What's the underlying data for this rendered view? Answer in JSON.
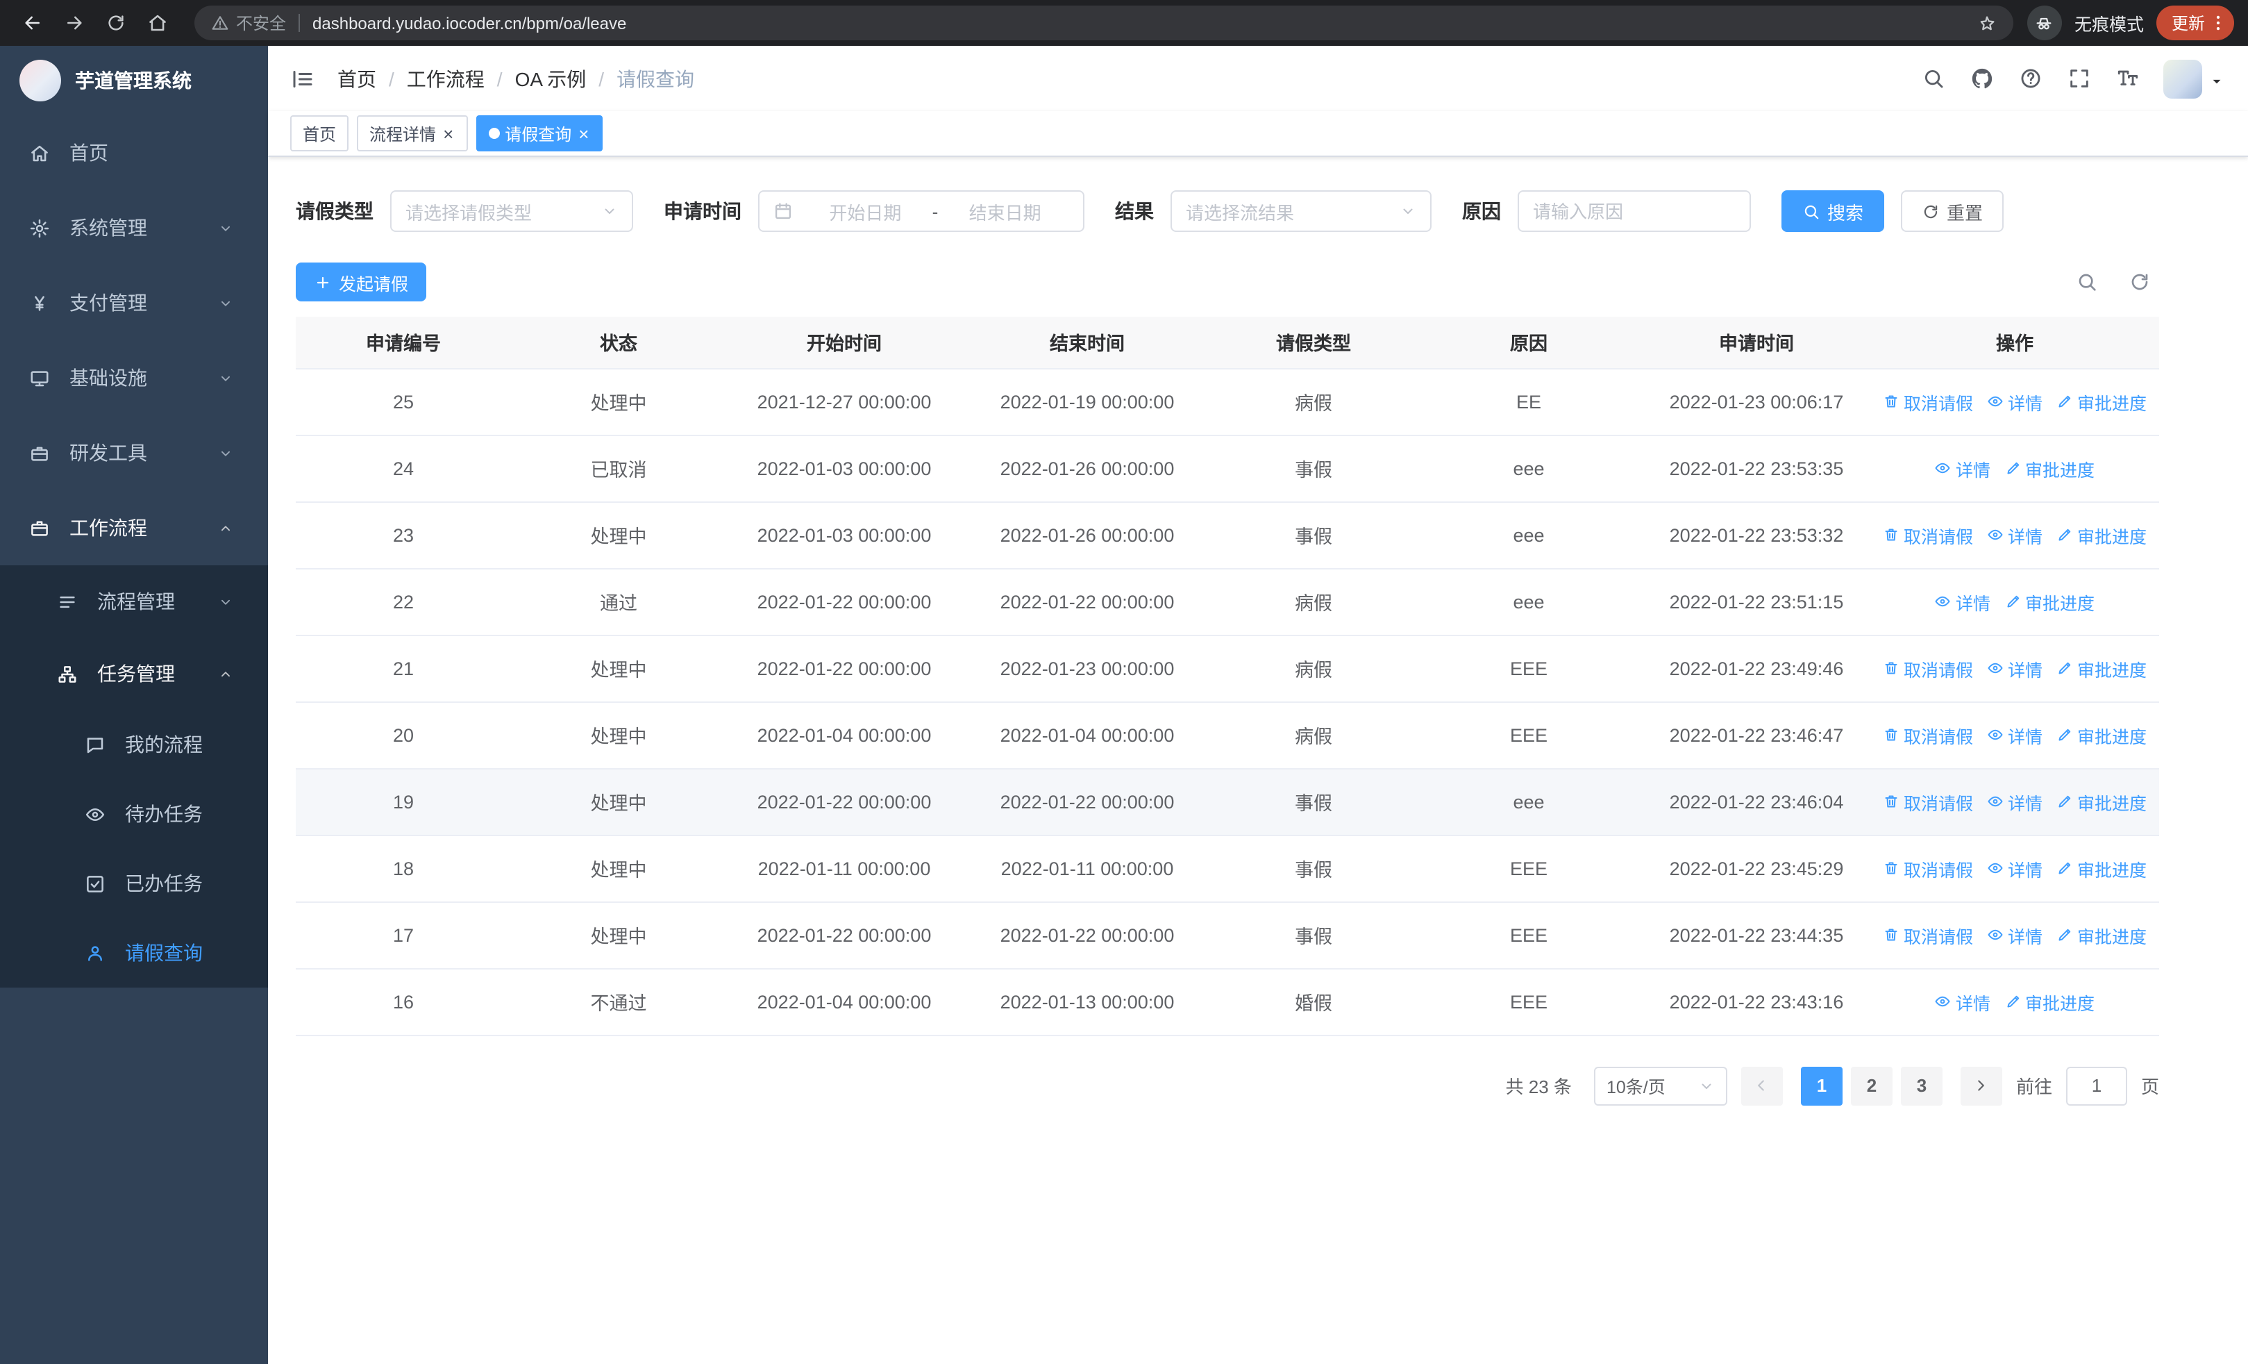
{
  "colors": {
    "primary": "#409eff",
    "sidebar_bg": "#304156",
    "sidebar_sub_bg": "#1f2d3d"
  },
  "browser": {
    "security_label": "不安全",
    "url": "dashboard.yudao.iocoder.cn/bpm/oa/leave",
    "incognito_label": "无痕模式",
    "update_label": "更新"
  },
  "sidebar": {
    "app_title": "芋道管理系统",
    "items": [
      {
        "id": "home",
        "label": "首页",
        "icon": "home-icon",
        "level": 1
      },
      {
        "id": "system-mgmt",
        "label": "系统管理",
        "icon": "gear-icon",
        "level": 1,
        "chevron": "down"
      },
      {
        "id": "payment-mgmt",
        "label": "支付管理",
        "icon": "yen-icon",
        "level": 1,
        "chevron": "down"
      },
      {
        "id": "infrastructure",
        "label": "基础设施",
        "icon": "monitor-icon",
        "level": 1,
        "chevron": "down"
      },
      {
        "id": "dev-tools",
        "label": "研发工具",
        "icon": "toolbox-icon",
        "level": 1,
        "chevron": "down"
      },
      {
        "id": "workflow",
        "label": "工作流程",
        "icon": "briefcase-icon",
        "level": 1,
        "chevron": "up",
        "open": true
      },
      {
        "id": "process-mgmt",
        "label": "流程管理",
        "icon": "flow-icon",
        "level": 2,
        "chevron": "down"
      },
      {
        "id": "task-mgmt",
        "label": "任务管理",
        "icon": "org-icon",
        "level": 2,
        "chevron": "up",
        "open": true
      },
      {
        "id": "my-process",
        "label": "我的流程",
        "icon": "chat-icon",
        "level": 3
      },
      {
        "id": "todo-tasks",
        "label": "待办任务",
        "icon": "eye-icon",
        "level": 3
      },
      {
        "id": "done-tasks",
        "label": "已办任务",
        "icon": "check-icon",
        "level": 3
      },
      {
        "id": "leave-query",
        "label": "请假查询",
        "icon": "user-icon",
        "level": 3,
        "active": true
      }
    ]
  },
  "header": {
    "breadcrumb": [
      "首页",
      "工作流程",
      "OA 示例",
      "请假查询"
    ]
  },
  "tabs": [
    {
      "id": "home",
      "label": "首页",
      "closable": false,
      "active": false
    },
    {
      "id": "process-detail",
      "label": "流程详情",
      "closable": true,
      "active": false
    },
    {
      "id": "leave-query",
      "label": "请假查询",
      "closable": true,
      "active": true
    }
  ],
  "filters": {
    "leave_type_label": "请假类型",
    "leave_type_placeholder": "请选择请假类型",
    "apply_time_label": "申请时间",
    "start_date_placeholder": "开始日期",
    "range_separator": "-",
    "end_date_placeholder": "结束日期",
    "result_label": "结果",
    "result_placeholder": "请选择流结果",
    "reason_label": "原因",
    "reason_placeholder": "请输入原因",
    "search_label": "搜索",
    "reset_label": "重置"
  },
  "toolbar": {
    "create_label": "发起请假"
  },
  "table": {
    "columns": [
      "申请编号",
      "状态",
      "开始时间",
      "结束时间",
      "请假类型",
      "原因",
      "申请时间",
      "操作"
    ],
    "action_labels": {
      "cancel": "取消请假",
      "detail": "详情",
      "progress": "审批进度"
    },
    "rows": [
      {
        "id": "25",
        "status": "处理中",
        "start_time": "2021-12-27 00:00:00",
        "end_time": "2022-01-19 00:00:00",
        "leave_type": "病假",
        "reason": "EE",
        "apply_time": "2022-01-23 00:06:17",
        "cancelable": true,
        "highlighted": false
      },
      {
        "id": "24",
        "status": "已取消",
        "start_time": "2022-01-03 00:00:00",
        "end_time": "2022-01-26 00:00:00",
        "leave_type": "事假",
        "reason": "eee",
        "apply_time": "2022-01-22 23:53:35",
        "cancelable": false,
        "highlighted": false
      },
      {
        "id": "23",
        "status": "处理中",
        "start_time": "2022-01-03 00:00:00",
        "end_time": "2022-01-26 00:00:00",
        "leave_type": "事假",
        "reason": "eee",
        "apply_time": "2022-01-22 23:53:32",
        "cancelable": true,
        "highlighted": false
      },
      {
        "id": "22",
        "status": "通过",
        "start_time": "2022-01-22 00:00:00",
        "end_time": "2022-01-22 00:00:00",
        "leave_type": "病假",
        "reason": "eee",
        "apply_time": "2022-01-22 23:51:15",
        "cancelable": false,
        "highlighted": false
      },
      {
        "id": "21",
        "status": "处理中",
        "start_time": "2022-01-22 00:00:00",
        "end_time": "2022-01-23 00:00:00",
        "leave_type": "病假",
        "reason": "EEE",
        "apply_time": "2022-01-22 23:49:46",
        "cancelable": true,
        "highlighted": false
      },
      {
        "id": "20",
        "status": "处理中",
        "start_time": "2022-01-04 00:00:00",
        "end_time": "2022-01-04 00:00:00",
        "leave_type": "病假",
        "reason": "EEE",
        "apply_time": "2022-01-22 23:46:47",
        "cancelable": true,
        "highlighted": false
      },
      {
        "id": "19",
        "status": "处理中",
        "start_time": "2022-01-22 00:00:00",
        "end_time": "2022-01-22 00:00:00",
        "leave_type": "事假",
        "reason": "eee",
        "apply_time": "2022-01-22 23:46:04",
        "cancelable": true,
        "highlighted": true
      },
      {
        "id": "18",
        "status": "处理中",
        "start_time": "2022-01-11 00:00:00",
        "end_time": "2022-01-11 00:00:00",
        "leave_type": "事假",
        "reason": "EEE",
        "apply_time": "2022-01-22 23:45:29",
        "cancelable": true,
        "highlighted": false
      },
      {
        "id": "17",
        "status": "处理中",
        "start_time": "2022-01-22 00:00:00",
        "end_time": "2022-01-22 00:00:00",
        "leave_type": "事假",
        "reason": "EEE",
        "apply_time": "2022-01-22 23:44:35",
        "cancelable": true,
        "highlighted": false
      },
      {
        "id": "16",
        "status": "不通过",
        "start_time": "2022-01-04 00:00:00",
        "end_time": "2022-01-13 00:00:00",
        "leave_type": "婚假",
        "reason": "EEE",
        "apply_time": "2022-01-22 23:43:16",
        "cancelable": false,
        "highlighted": false
      }
    ]
  },
  "pagination": {
    "total_label": "共 23 条",
    "page_size_label": "10条/页",
    "pages": [
      "1",
      "2",
      "3"
    ],
    "active_page": "1",
    "goto_label": "前往",
    "goto_value": "1",
    "unit_label": "页"
  }
}
